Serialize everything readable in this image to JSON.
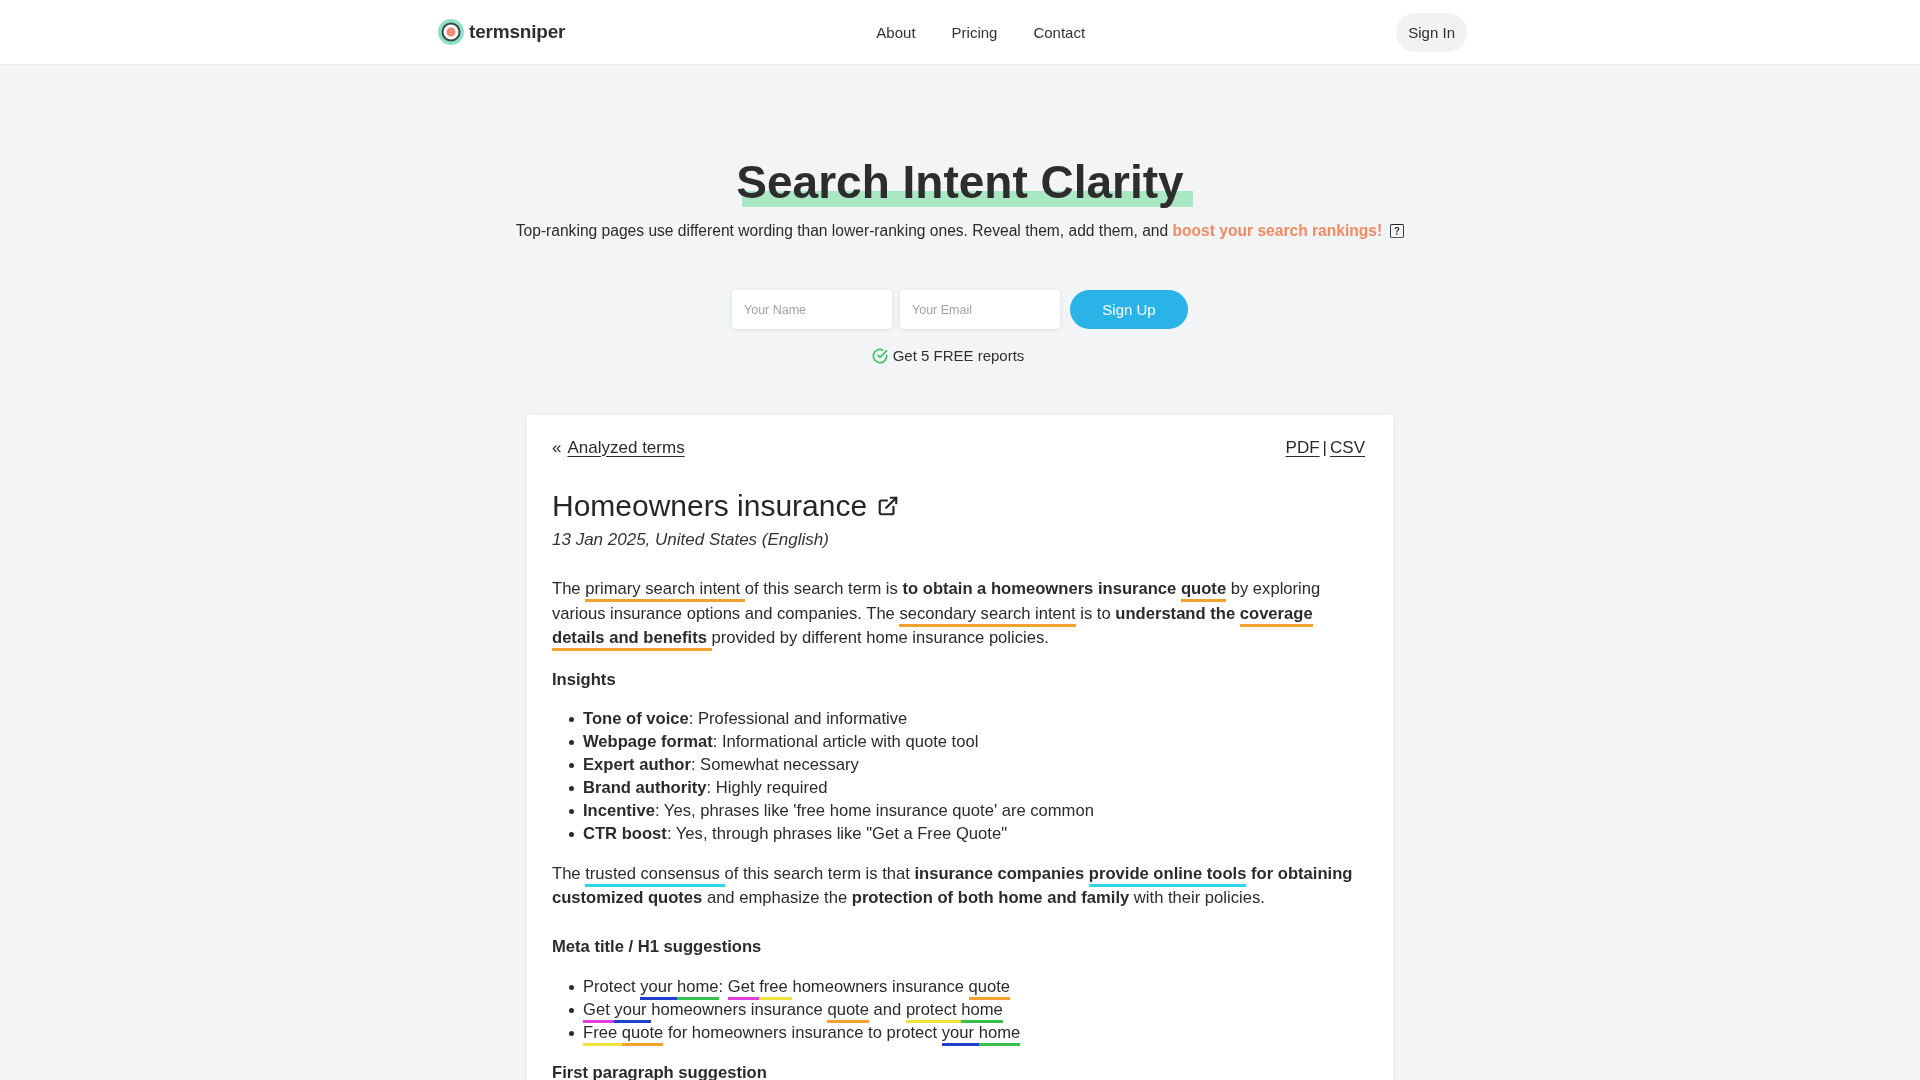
{
  "header": {
    "brand": "termsniper",
    "nav": [
      "About",
      "Pricing",
      "Contact"
    ],
    "sign_in": "Sign In"
  },
  "hero": {
    "title": "Search Intent Clarity",
    "subtitle": "Top-ranking pages use different wording than lower-ranking ones. Reveal them, add them, and ",
    "subtitle_emphasis": "boost your search rankings!"
  },
  "signup": {
    "fields": [
      {
        "placeholder": "Your Name"
      },
      {
        "placeholder": "Your Email"
      }
    ],
    "button": "Sign Up",
    "note": "Get 5 FREE reports"
  },
  "report": {
    "back_symbol": "«",
    "back_link": "Analyzed terms",
    "exports": [
      "PDF",
      "CSV"
    ],
    "export_separator": "|",
    "title": "Homeowners insurance",
    "date": "13 Jan 2025, United States (English)",
    "intro": [
      {
        "text": "The "
      },
      {
        "text": "primary search intent ",
        "color": "#f5a130"
      },
      {
        "text": "of this search term is **to obtain a homeowners insurance** "
      },
      {
        "text": "**quote**",
        "color": "#f5a130"
      },
      {
        "text": " by exploring various insurance options and companies. The "
      },
      {
        "text": "secondary search intent",
        "color": "#f5a130"
      },
      {
        "text": " is to **understand the** "
      },
      {
        "text": "**coverage details and benefits** ",
        "color": "#f5a130"
      },
      {
        "text": "provided by different home insurance policies."
      }
    ],
    "insights_heading": "Insights",
    "insights": [
      "**Tone of voice**: Professional and informative",
      "**Webpage format**: Informational article with quote tool",
      "**Expert author**: Somewhat necessary",
      "**Brand authority**: Highly required",
      "**Incentive**: Yes, phrases like 'free home insurance quote' are common",
      "**CTR boost**: Yes, through phrases like \"Get a Free Quote\""
    ],
    "consensus": [
      {
        "text": "The "
      },
      {
        "text": "trusted consensus ",
        "color": "#2fd5e6"
      },
      {
        "text": "of this search term is that **insurance companies** "
      },
      {
        "text": "**provide online tools**",
        "color": "#2fd5e6"
      },
      {
        "text": " **for obtaining customized quotes** and emphasize the **protection of both home and family** with their policies."
      }
    ],
    "suggestions_heading": "Meta title / H1 suggestions",
    "suggestions": [
      {
        "segments": [
          {
            "text": "Protect "
          },
          {
            "text": "your ",
            "color": "#1f3fcf"
          },
          {
            "text": "home",
            "color": "#36c24a"
          },
          {
            "text": ": "
          },
          {
            "text": "Get ",
            "color": "#e13ddf"
          },
          {
            "text": "free ",
            "color": "#efe23a"
          },
          {
            "text": "homeowners insurance "
          },
          {
            "text": "quote",
            "color": "#f5a130"
          }
        ]
      },
      {
        "segments": [
          {
            "text": "Get ",
            "color": "#e13ddf"
          },
          {
            "text": "your ",
            "color": "#1f3fcf"
          },
          {
            "text": "homeowners insurance "
          },
          {
            "text": "quote",
            "color": "#f5a130"
          },
          {
            "text": " and "
          },
          {
            "text": "protect ",
            "color": "#efe23a"
          },
          {
            "text": "home",
            "color": "#36c24a"
          }
        ]
      },
      {
        "segments": [
          {
            "text": "Free ",
            "color": "#efe23a"
          },
          {
            "text": "quote",
            "color": "#f5a130"
          },
          {
            "text": " for homeowners insurance to protect "
          },
          {
            "text": "your ",
            "color": "#1f3fcf"
          },
          {
            "text": "home",
            "color": "#36c24a"
          }
        ]
      }
    ],
    "next_heading": "First paragraph suggestion"
  }
}
